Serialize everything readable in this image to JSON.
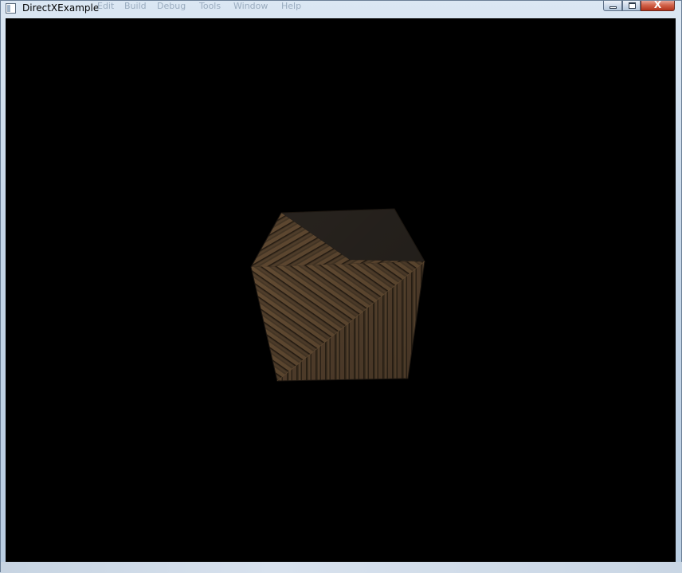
{
  "window": {
    "title": "DirectXExample",
    "icon": "application-window-icon",
    "background_menu_ghosts": [
      "Edit",
      "Build",
      "Debug",
      "Tools",
      "Window",
      "Help"
    ],
    "caption_buttons": {
      "minimize": "minimize-icon",
      "maximize": "maximize-icon",
      "close": "X"
    },
    "colors": {
      "client_background": "#000000",
      "titlebar": "#dbe7f3",
      "close_button": "#c7442b"
    }
  },
  "scene": {
    "object": "textured-cube",
    "texture": "wood-crate",
    "colors": {
      "top_face": "#2a2520",
      "front_face": "#4a3a28",
      "wood_light": "#6b5237",
      "wood_dark": "#2f2417"
    }
  }
}
